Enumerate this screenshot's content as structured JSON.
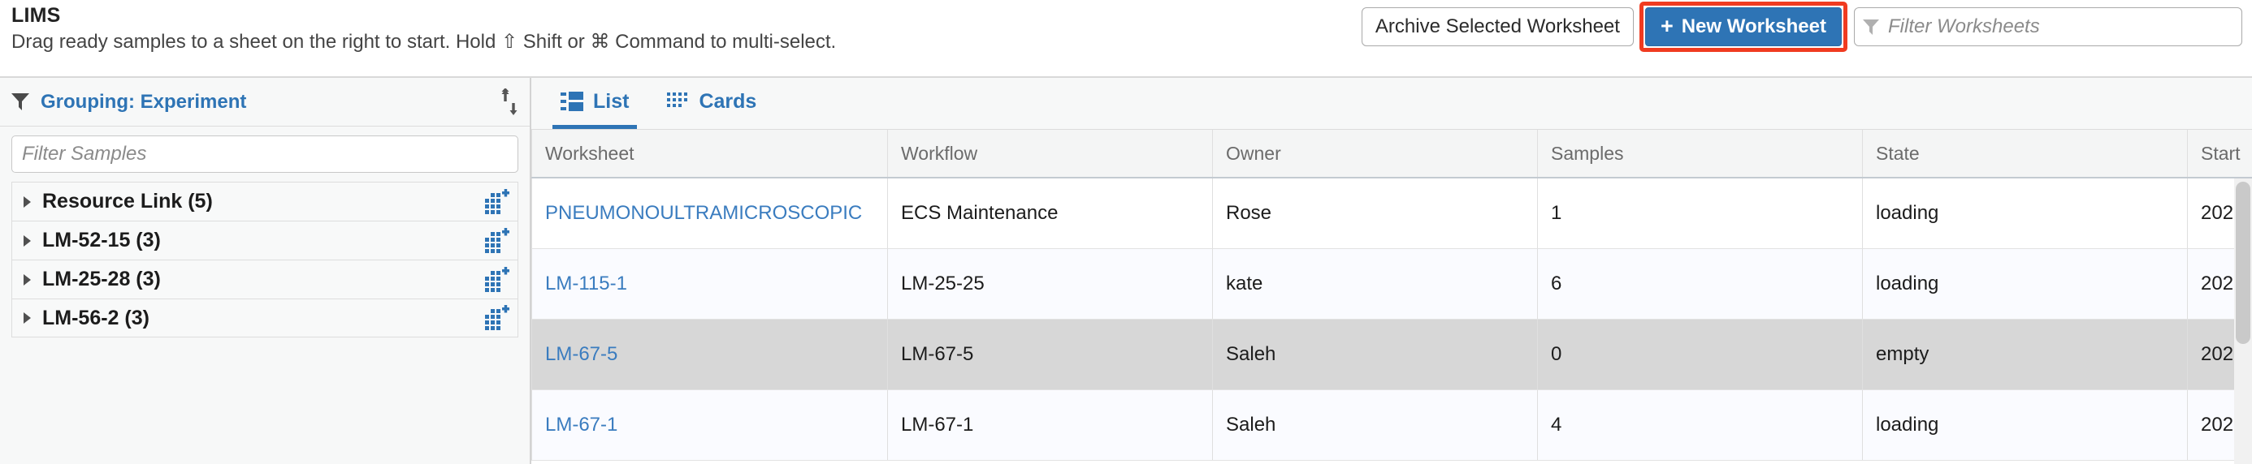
{
  "header": {
    "title": "LIMS",
    "subtitle": "Drag ready samples to a sheet on the right to start. Hold ⇧ Shift or ⌘ Command to multi-select.",
    "archive_button_label": "Archive Selected Worksheet",
    "new_worksheet_button_label": "New Worksheet",
    "new_worksheet_plus": "+",
    "worksheet_filter_placeholder": "Filter Worksheets",
    "worksheet_filter_value": ""
  },
  "sidebar": {
    "grouping_label": "Grouping: Experiment",
    "sort_icon": "sort-updown-icon",
    "filter_icon": "funnel-icon",
    "sample_filter_placeholder": "Filter Samples",
    "sample_filter_value": "",
    "groups": [
      {
        "label": "Resource Link (5)",
        "add_icon": "grid-plus-icon"
      },
      {
        "label": "LM-52-15 (3)",
        "add_icon": "grid-plus-icon"
      },
      {
        "label": "LM-25-28 (3)",
        "add_icon": "grid-plus-icon"
      },
      {
        "label": "LM-56-2 (3)",
        "add_icon": "grid-plus-icon"
      }
    ]
  },
  "main": {
    "tabs": [
      {
        "label": "List",
        "icon": "list-view-icon",
        "active": true
      },
      {
        "label": "Cards",
        "icon": "cards-view-icon",
        "active": false
      }
    ],
    "table": {
      "columns": [
        "Worksheet",
        "Workflow",
        "Owner",
        "Samples",
        "State",
        "Start"
      ],
      "rows": [
        {
          "worksheet": "PNEUMONOULTRAMICROSCOPIC",
          "workflow": "ECS Maintenance",
          "owner": "Rose",
          "samples": "1",
          "state": "loading",
          "start": "202"
        },
        {
          "worksheet": "LM-115-1",
          "workflow": "LM-25-25",
          "owner": "kate",
          "samples": "6",
          "state": "loading",
          "start": "202"
        },
        {
          "worksheet": "LM-67-5",
          "workflow": "LM-67-5",
          "owner": "Saleh",
          "samples": "0",
          "state": "empty",
          "start": "202"
        },
        {
          "worksheet": "LM-67-1",
          "workflow": "LM-67-1",
          "owner": "Saleh",
          "samples": "4",
          "state": "loading",
          "start": "202"
        }
      ]
    }
  },
  "colors": {
    "accent_blue": "#2e74b5",
    "link_blue": "#3a7cbf",
    "highlight_red": "#f03b20",
    "selected_row_gray": "#d7d7d7",
    "tint_row": "#fafbff",
    "header_gray": "#f4f5f5"
  }
}
